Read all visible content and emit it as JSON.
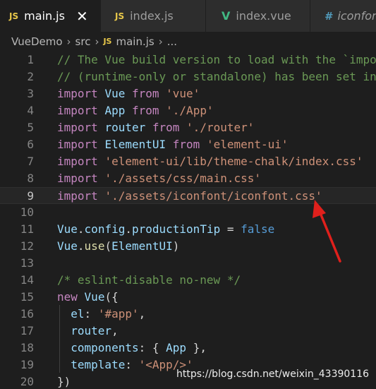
{
  "tabs": [
    {
      "icon": "JS",
      "label": "main.js",
      "active": true,
      "close": "✕"
    },
    {
      "icon": "JS",
      "label": "index.js"
    },
    {
      "icon": "V",
      "label": "index.vue"
    },
    {
      "icon": "#",
      "label": "iconfont"
    }
  ],
  "breadcrumb": {
    "parts": [
      "VueDemo",
      "src"
    ],
    "file_icon": "JS",
    "file": "main.js",
    "tail": "...",
    "separator": "›"
  },
  "code_lines": [
    {
      "num": "1",
      "text": "// The Vue build version to load with the `impo"
    },
    {
      "num": "2",
      "text": "// (runtime-only or standalone) has been set in"
    },
    {
      "num": "3",
      "text": "import Vue from 'vue'"
    },
    {
      "num": "4",
      "text": "import App from './App'"
    },
    {
      "num": "5",
      "text": "import router from './router'"
    },
    {
      "num": "6",
      "text": "import ElementUI from 'element-ui'"
    },
    {
      "num": "7",
      "text": "import 'element-ui/lib/theme-chalk/index.css'"
    },
    {
      "num": "8",
      "text": "import './assets/css/main.css'"
    },
    {
      "num": "9",
      "text": "import './assets/iconfont/iconfont.css'"
    },
    {
      "num": "10",
      "text": ""
    },
    {
      "num": "11",
      "text": "Vue.config.productionTip = false"
    },
    {
      "num": "12",
      "text": "Vue.use(ElementUI)"
    },
    {
      "num": "13",
      "text": ""
    },
    {
      "num": "14",
      "text": "/* eslint-disable no-new */"
    },
    {
      "num": "15",
      "text": "new Vue({"
    },
    {
      "num": "16",
      "text": "  el: '#app',"
    },
    {
      "num": "17",
      "text": "  router,"
    },
    {
      "num": "18",
      "text": "  components: { App },"
    },
    {
      "num": "19",
      "text": "  template: '<App/>'"
    },
    {
      "num": "20",
      "text": "})"
    }
  ],
  "current_line": "9",
  "watermark": "https://blog.csdn.net/weixin_43390116",
  "colors": {
    "background": "#1e1e1e",
    "comment": "#6a9955",
    "keyword": "#c586c0",
    "string": "#ce9178",
    "variable": "#9cdcfe",
    "class": "#4ec9b0",
    "boolean": "#569cd6",
    "arrow": "#e0201c"
  },
  "annotation": {
    "type": "red-arrow-icon"
  }
}
